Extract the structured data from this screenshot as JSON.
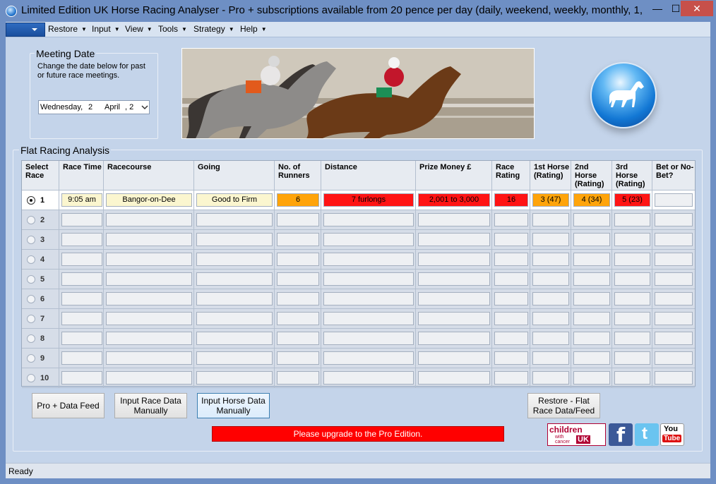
{
  "window": {
    "title": "Limited Edition UK Horse Racing Analyser  - Pro + subscriptions available from 20 pence per day (daily, weekend, weekly, monthly, 1,...",
    "minimize_glyph": "—",
    "maximize_glyph": "☐",
    "close_glyph": "✕"
  },
  "menu": {
    "items": [
      "Restore",
      "Input",
      "View",
      "Tools",
      "Strategy",
      "Help"
    ],
    "arrow": "▼"
  },
  "meeting": {
    "title": "Meeting Date",
    "help": "Change the date below for past or future race meetings.",
    "weekday": "Wednesday,",
    "day": "2",
    "month": "April",
    "year_partial": ", 2"
  },
  "analysis": {
    "title": "Flat Racing Analysis",
    "headers": [
      "Select Race",
      "Race Time",
      "Racecourse",
      "Going",
      "No. of Runners",
      "Distance",
      "Prize Money £",
      "Race Rating",
      "1st Horse (Rating)",
      "2nd Horse (Rating)",
      "3rd Horse (Rating)",
      "Bet or No-Bet?"
    ],
    "rows": [
      "1",
      "2",
      "3",
      "4",
      "5",
      "6",
      "7",
      "8",
      "9",
      "10"
    ],
    "selected_row": 1,
    "first_row": {
      "race_time": "9:05 am",
      "racecourse": "Bangor-on-Dee",
      "going": "Good to Firm",
      "runners": "6",
      "distance": "7 furlongs",
      "prize_money": "2,001 to 3,000",
      "race_rating": "16",
      "first_horse": "3 (47)",
      "second_horse": "4 (34)",
      "third_horse": "5 (23)",
      "bet": ""
    }
  },
  "buttons": {
    "pro_feed": "Pro + Data Feed",
    "input_race": "Input Race Data Manually",
    "input_horse": "Input Horse Data Manually",
    "restore_flat": "Restore - Flat Race Data/Feed"
  },
  "upgrade_message": "Please upgrade to the Pro Edition.",
  "social": {
    "children": "children",
    "with_cancer": "with cancer",
    "uk": "UK",
    "facebook": "f",
    "twitter": "t",
    "you": "You",
    "tube": "Tube"
  },
  "status": "Ready",
  "colors": {
    "cream": "#fbf6cf",
    "orange": "#ffa40a",
    "red": "#ff1414",
    "title_bar": "#6e8fc4",
    "client": "#c4d4ea"
  }
}
